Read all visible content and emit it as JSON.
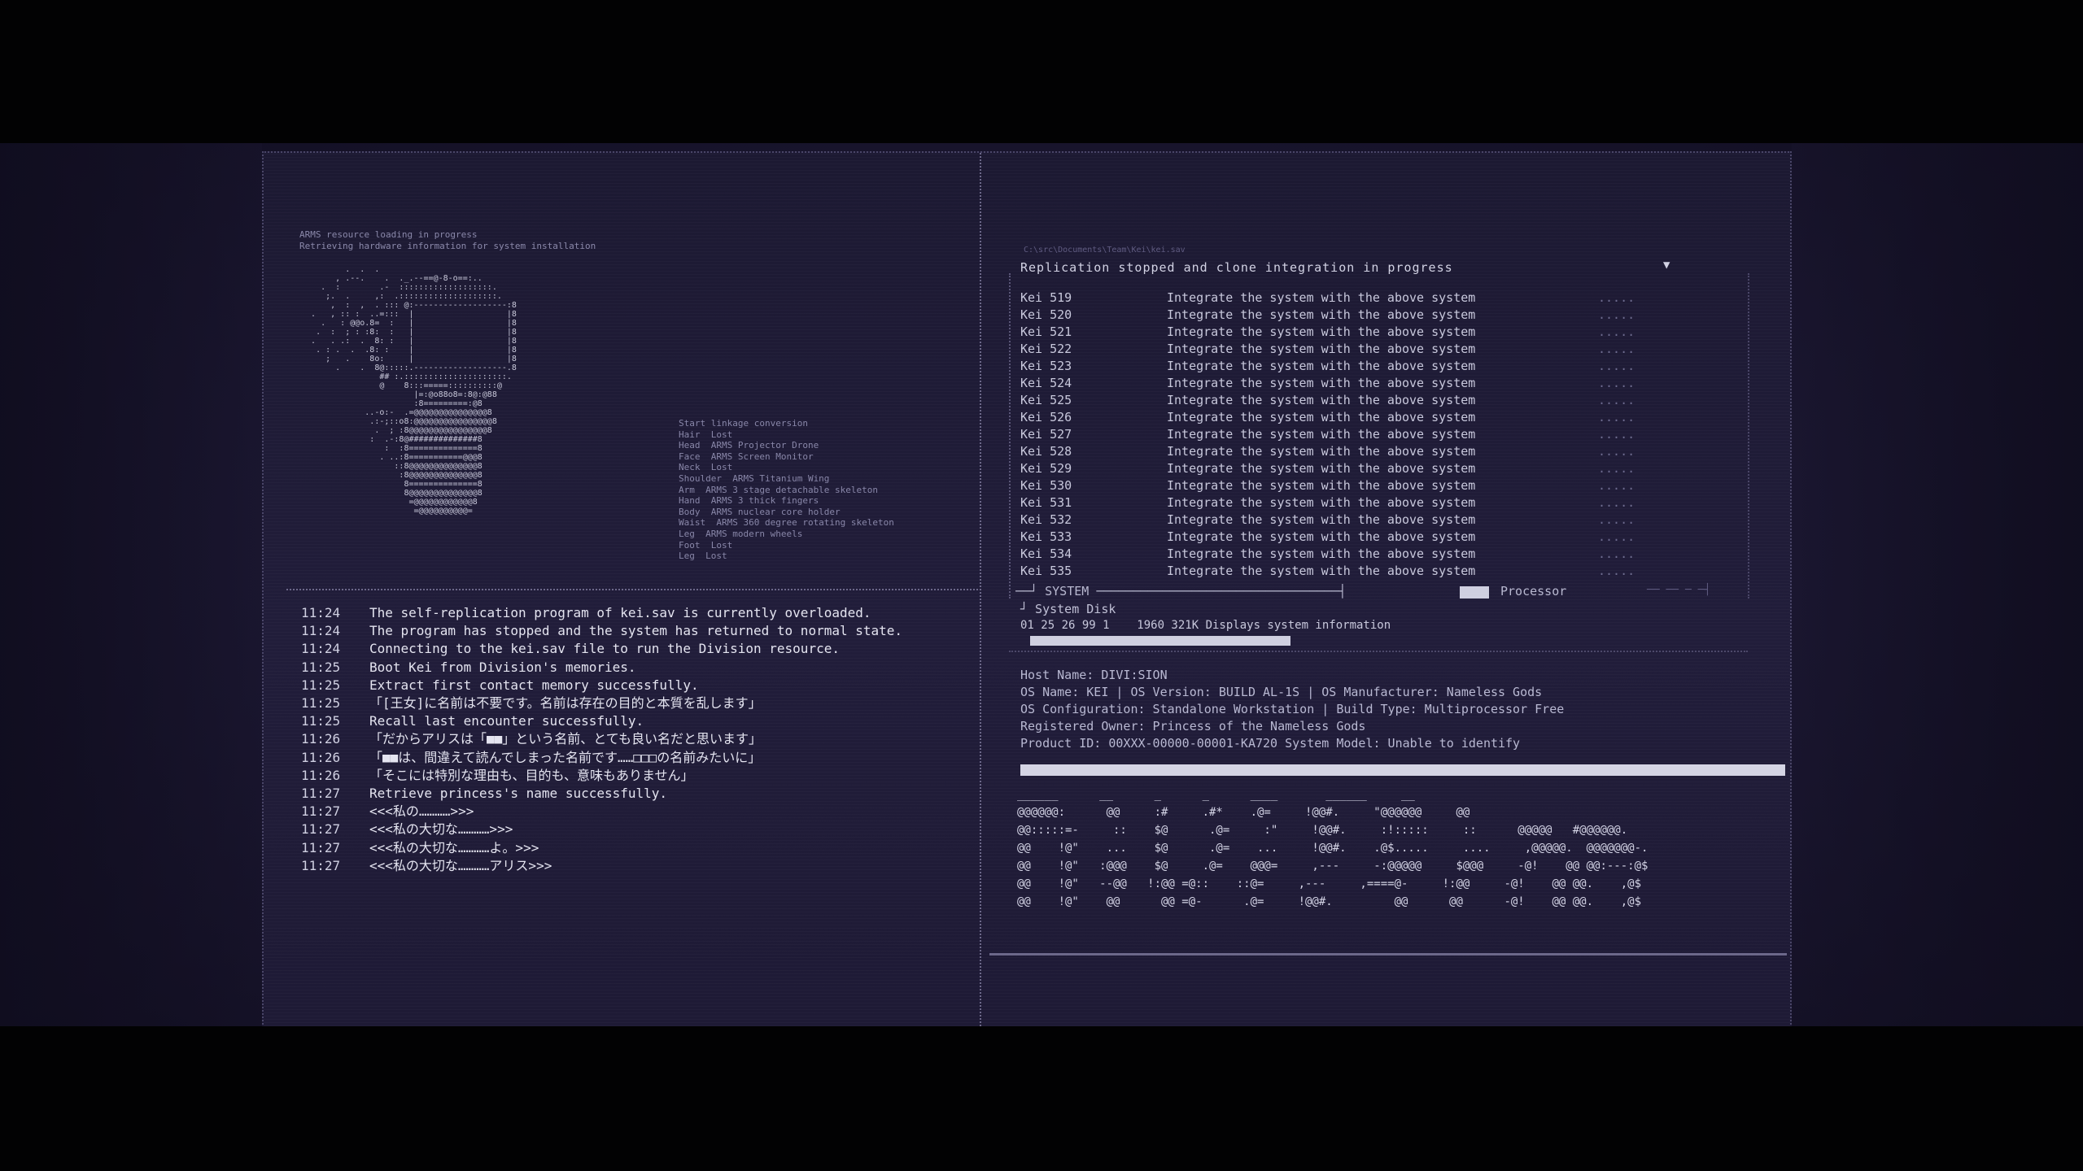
{
  "left": {
    "resource_header": "ARMS resource loading in progress\nRetrieving hardware information for system installation",
    "robot_art": "          .  .  .\n        , .--.    .  ._.--==@-8-o==:..\n     .  :        .-  :::::::::::::::::::.\n      ;.  .     ,:  .::::::::::::::::::::.\n       ,  :  ,  . ::: @:-------------------:8\n   .   , :: :  ..=:::  |                   |8\n     .   : @@o.8=  :   |                   |8\n    .  :  ; : :8:  :   |                   |8\n   .   . .:  .  8: :   |                   |8\n    . : .  .  .8: :    |                   |8\n      ;   .    8o:     |                   |8\n        .    .  8@:::::.-------------------.8\n                 ## :.:::::::::::::::::::::.\n                 @    8:::=====::::::::::@\n                        |=:@o88o8=:8@:@88\n                        :8=========:@8\n              ..-o:-  .=@@@@@@@@@@@@@@@8\n               .:-;::o8:@@@@@@@@@@@@@@@@8\n                .  ; :8@@@@@@@@@@@@@@@@8\n               :  .-:8@##############8\n                  :  :8==============8\n                 . ..:8===========@@@8\n                    ::8@@@@@@@@@@@@@@8\n                     :8@@@@@@@@@@@@@@8\n                      8==============8\n                      8@@@@@@@@@@@@@@8\n                       =@@@@@@@@@@@@8\n                        =@@@@@@@@@@=",
    "linkage_info": "Start linkage conversion\nHair  Lost\nHead  ARMS Projector Drone\nFace  ARMS Screen Monitor\nNeck  Lost\nShoulder  ARMS Titanium Wing\nArm  ARMS 3 stage detachable skeleton\nHand  ARMS 3 thick fingers\nBody  ARMS nuclear core holder\nWaist  ARMS 360 degree rotating skeleton\nLeg  ARMS modern wheels\nFoot  Lost\nLeg  Lost",
    "log": [
      {
        "time": "11:24",
        "msg": "The self-replication program of kei.sav is currently overloaded."
      },
      {
        "time": "11:24",
        "msg": "The program has stopped and the system has returned to normal state."
      },
      {
        "time": "11:24",
        "msg": "Connecting to the kei.sav file to run the Division resource."
      },
      {
        "time": "11:25",
        "msg": "Boot Kei from Division's memories."
      },
      {
        "time": "11:25",
        "msg": "Extract first contact memory successfully."
      },
      {
        "time": "11:25",
        "msg": "「[王女]に名前は不要です。名前は存在の目的と本質を乱します」"
      },
      {
        "time": "11:25",
        "msg": "Recall last encounter successfully."
      },
      {
        "time": "11:26",
        "msg": "「だからアリスは「■■」という名前、とても良い名だと思います」"
      },
      {
        "time": "11:26",
        "msg": "「■■は、間違えて読んでしまった名前です……□□□の名前みたいに」"
      },
      {
        "time": "11:26",
        "msg": "「そこには特別な理由も、目的も、意味もありません」"
      },
      {
        "time": "11:27",
        "msg": "Retrieve princess's name successfully."
      },
      {
        "time": "11:27",
        "msg": "<<<私の…………>>>"
      },
      {
        "time": "11:27",
        "msg": "<<<私の大切な…………>>>"
      },
      {
        "time": "11:27",
        "msg": "<<<私の大切な…………よ。>>>"
      },
      {
        "time": "11:27",
        "msg": "<<<私の大切な…………アリス>>>"
      }
    ]
  },
  "right": {
    "path_line": "C:\\src\\Documents\\Team\\Kei\\kei.sav",
    "replication_title": "Replication stopped and clone integration in progress",
    "dropdown_arrow": "▼",
    "kei_rows": [
      {
        "name": "Kei 519",
        "text": "Integrate the system with the above system",
        "dots": "....."
      },
      {
        "name": "Kei 520",
        "text": "Integrate the system with the above system",
        "dots": "....."
      },
      {
        "name": "Kei 521",
        "text": "Integrate the system with the above system",
        "dots": "....."
      },
      {
        "name": "Kei 522",
        "text": "Integrate the system with the above system",
        "dots": "....."
      },
      {
        "name": "Kei 523",
        "text": "Integrate the system with the above system",
        "dots": "....."
      },
      {
        "name": "Kei 524",
        "text": "Integrate the system with the above system",
        "dots": "....."
      },
      {
        "name": "Kei 525",
        "text": "Integrate the system with the above system",
        "dots": "....."
      },
      {
        "name": "Kei 526",
        "text": "Integrate the system with the above system",
        "dots": "....."
      },
      {
        "name": "Kei 527",
        "text": "Integrate the system with the above system",
        "dots": "....."
      },
      {
        "name": "Kei 528",
        "text": "Integrate the system with the above system",
        "dots": "....."
      },
      {
        "name": "Kei 529",
        "text": "Integrate the system with the above system",
        "dots": "....."
      },
      {
        "name": "Kei 530",
        "text": "Integrate the system with the above system",
        "dots": "....."
      },
      {
        "name": "Kei 531",
        "text": "Integrate the system with the above system",
        "dots": "....."
      },
      {
        "name": "Kei 532",
        "text": "Integrate the system with the above system",
        "dots": "....."
      },
      {
        "name": "Kei 533",
        "text": "Integrate the system with the above system",
        "dots": "....."
      },
      {
        "name": "Kei 534",
        "text": "Integrate the system with the above system",
        "dots": "....."
      },
      {
        "name": "Kei 535",
        "text": "Integrate the system with the above system",
        "dots": "....."
      }
    ],
    "system_line": "──┘ SYSTEM ─────────────────────────────────┤",
    "processor_label": "Processor",
    "processor_tail": "── ── ─ ─┤",
    "system_disk_label": "┘ System Disk",
    "disk_line": "01 25 26 99 1    1960 321K Displays system information",
    "sysinfo": "Host Name: DIVI:SION\nOS Name: KEI | OS Version: BUILD AL-1S | OS Manufacturer: Nameless Gods\nOS Configuration: Standalone Workstation | Build Type: Multiprocessor Free\nRegistered Owner: Princess of the Nameless Gods\nProduct ID: 00XXX-00000-00001-KA720 System Model: Unable to identify",
    "banner_art": "______      __      _      _      ____       ______     __\n@@@@@@:      @@     :#     .#*    .@=     !@@#.     \"@@@@@@     @@\n@@:::::=-     ::    $@      .@=     :\"     !@@#.     :!:::::     ::      @@@@@   #@@@@@@.\n@@    !@\"    ...    $@      .@=    ...     !@@#.    .@$.....     ....     ,@@@@@.  @@@@@@@-.\n@@    !@\"   :@@@    $@     .@=    @@@=     ,---     -:@@@@@     $@@@     -@!    @@ @@:---:@$\n@@    !@\"   --@@   !:@@ =@::    ::@=     ,---     ,====@-     !:@@     -@!    @@ @@.    ,@$\n@@    !@\"    @@      @@ =@-      .@=     !@@#.         @@      @@      -@!    @@ @@.    ,@$"
  }
}
